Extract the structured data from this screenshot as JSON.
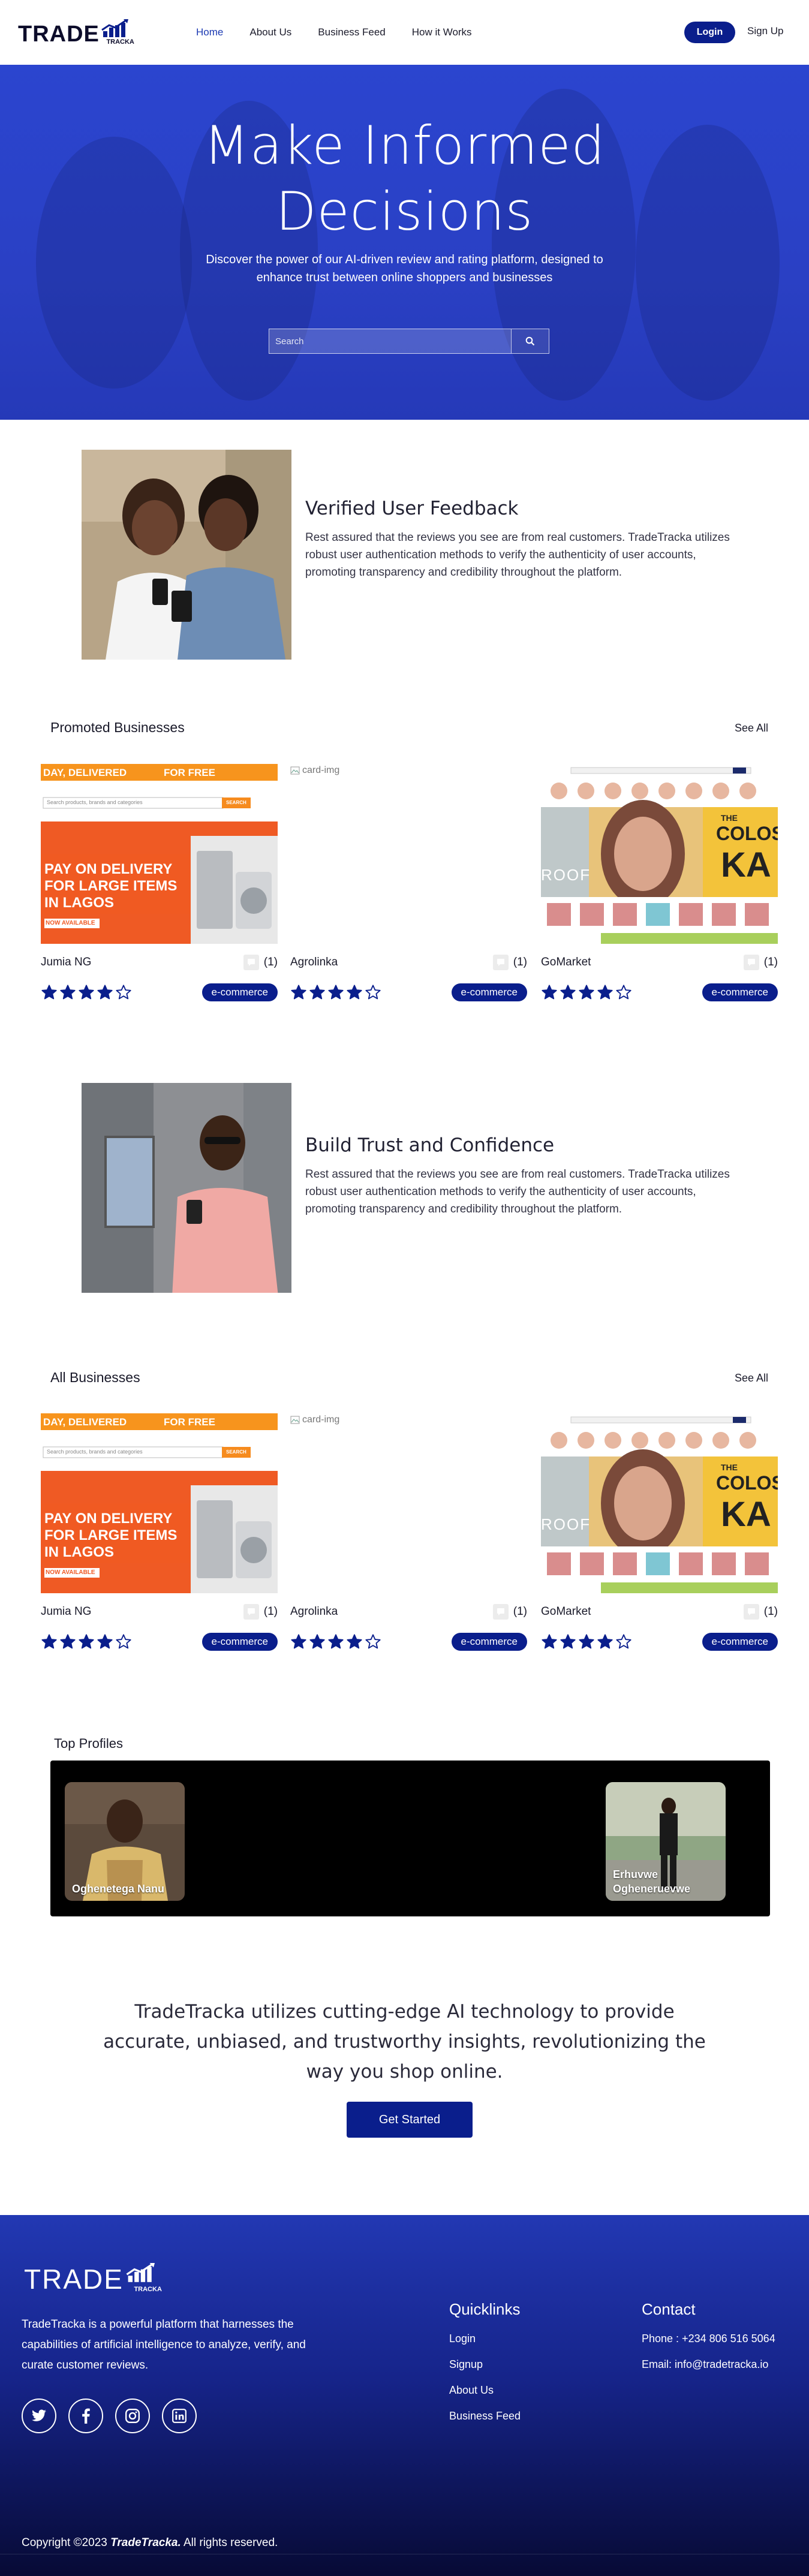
{
  "nav": {
    "logo_text": "TRADE",
    "logo_sub": "TRACKA",
    "links": [
      {
        "label": "Home",
        "active": true
      },
      {
        "label": "About Us",
        "active": false
      },
      {
        "label": "Business Feed",
        "active": false
      },
      {
        "label": "How it Works",
        "active": false
      }
    ],
    "login_label": "Login",
    "signup_label": "Sign Up"
  },
  "hero": {
    "title_line1": "Make Informed",
    "title_line2": "Decisions",
    "subtitle": "Discover the power of our AI-driven review and rating platform, designed to enhance trust between online shoppers and businesses",
    "search_placeholder": "Search"
  },
  "feature1": {
    "title": "Verified User Feedback",
    "body": "Rest assured that the reviews you see are from real customers. TradeTracka utilizes robust user authentication methods to verify the authenticity of user accounts, promoting transparency and credibility throughout the platform."
  },
  "feature2": {
    "title": "Build Trust and Confidence",
    "body": "Rest assured that the reviews you see are from real customers. TradeTracka utilizes robust user authentication methods to verify the authenticity of user accounts, promoting transparency and credibility throughout the platform."
  },
  "promoted": {
    "title": "Promoted Businesses",
    "see_all": "See All",
    "cards": [
      {
        "name": "Jumia NG",
        "reviews": "(1)",
        "rating": 4,
        "tag": "e-commerce",
        "image": "jumia"
      },
      {
        "name": "Agrolinka",
        "reviews": "(1)",
        "rating": 4,
        "tag": "e-commerce",
        "image": "broken",
        "alt": "card-img"
      },
      {
        "name": "GoMarket",
        "reviews": "(1)",
        "rating": 4,
        "tag": "e-commerce",
        "image": "gomarket"
      }
    ]
  },
  "all_businesses": {
    "title": "All Businesses",
    "see_all": "See All",
    "cards": [
      {
        "name": "Jumia NG",
        "reviews": "(1)",
        "rating": 4,
        "tag": "e-commerce",
        "image": "jumia"
      },
      {
        "name": "Agrolinka",
        "reviews": "(1)",
        "rating": 4,
        "tag": "e-commerce",
        "image": "broken",
        "alt": "card-img"
      },
      {
        "name": "GoMarket",
        "reviews": "(1)",
        "rating": 4,
        "tag": "e-commerce",
        "image": "gomarket"
      }
    ]
  },
  "jumia_banner": {
    "top_left": "DAY, DELIVERED",
    "top_right": "FOR FREE",
    "search_placeholder": "Search products, brands and categories",
    "search_btn": "SEARCH",
    "headline1": "PAY ON DELIVERY",
    "headline2": "FOR LARGE ITEMS",
    "headline3": "IN LAGOS",
    "badge": "NOW AVAILABLE"
  },
  "gomarket_banner": {
    "big_text1": "THE",
    "big_text2": "COLOS",
    "big_text3": "KA",
    "roof_text": "ROOF"
  },
  "profiles": {
    "title": "Top Profiles",
    "items": [
      {
        "name": "Oghenetega Nanu"
      },
      {
        "name": "Erhuvwe Ogheneruevwe"
      }
    ]
  },
  "cta": {
    "text": "TradeTracka utilizes cutting-edge AI technology to provide accurate, unbiased, and trustworthy insights, revolutionizing the way you shop online.",
    "button": "Get Started"
  },
  "footer": {
    "logo_text": "TRADE",
    "logo_sub": "TRACKA",
    "about": "TradeTracka is a powerful platform that harnesses the capabilities of artificial intelligence to analyze, verify, and curate customer reviews.",
    "socials": [
      "twitter-icon",
      "facebook-icon",
      "instagram-icon",
      "linkedin-icon"
    ],
    "quicklinks_title": "Quicklinks",
    "quicklinks": [
      "Login",
      "Signup",
      "About Us",
      "Business Feed"
    ],
    "contact_title": "Contact",
    "phone": "Phone : +234 806 516 5064",
    "email": "Email: info@tradetracka.io",
    "copyright_prefix": "Copyright ©2023 ",
    "copyright_brand": "TradeTracka.",
    "copyright_suffix": " All rights reserved."
  },
  "colors": {
    "brand_blue": "#0a1e8c",
    "hero_blue": "#2b45cf",
    "accent_orange": "#f5841f"
  }
}
